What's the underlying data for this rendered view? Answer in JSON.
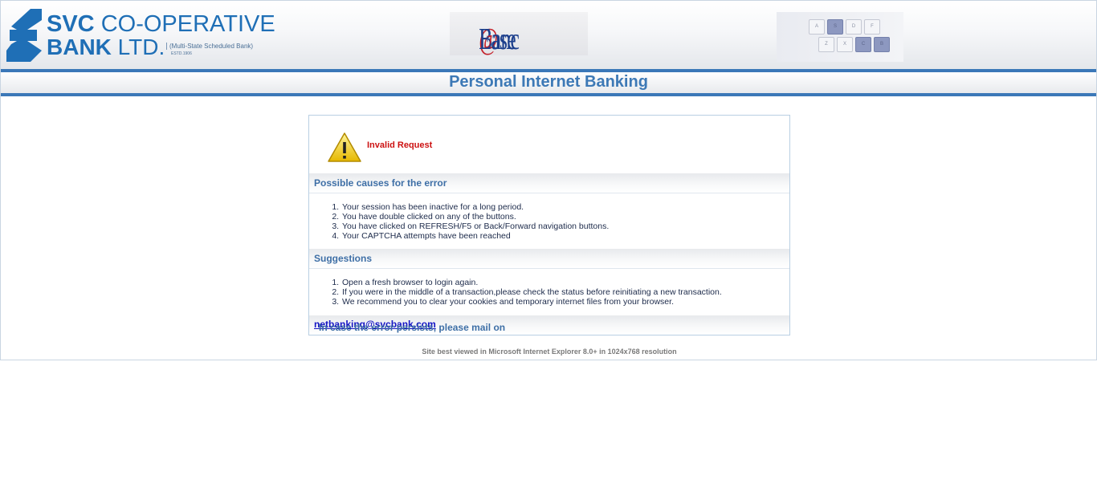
{
  "header": {
    "bank_name_line1_bold": "SVC",
    "bank_name_line1_rest": " CO-OPERATIVE",
    "bank_name_line2_bold": "BANK",
    "bank_name_line2_rest": " LTD.",
    "bank_tagline": "(Multi-State Scheduled Bank)",
    "bank_established": "ESTD.1906",
    "product_logo_part1": "Banc",
    "product_logo_at": "@",
    "product_logo_part2": "Ease",
    "keyboard_keys_row1": [
      "A",
      "S",
      "D",
      "F"
    ],
    "keyboard_keys_row2": [
      "Z",
      "X",
      "C",
      "B"
    ]
  },
  "title": "Personal Internet Banking",
  "error": {
    "message": "Invalid Request",
    "causes_heading": "Possible causes for the error",
    "causes": [
      "Your session has been inactive for a long period.",
      "You have double clicked on any of the buttons.",
      "You have clicked on REFRESH/F5 or Back/Forward navigation buttons.",
      "Your CAPTCHA attempts have been reached"
    ],
    "suggestions_heading": "Suggestions",
    "suggestions": [
      "Open a fresh browser to login again.",
      "If you were in the middle of a transaction,please check the status before reinitiating a new transaction.",
      "We recommend you to clear your cookies and temporary internet files from your browser."
    ],
    "persist_text": "In case the error persists, please mail on ",
    "email": "netbanking@svcbank.com"
  },
  "footer_note": "Site best viewed in Microsoft Internet Explorer 8.0+ in 1024x768 resolution",
  "colors": {
    "accent_blue": "#3b78b8",
    "error_red": "#cc1111",
    "link_blue": "#1515c4"
  }
}
